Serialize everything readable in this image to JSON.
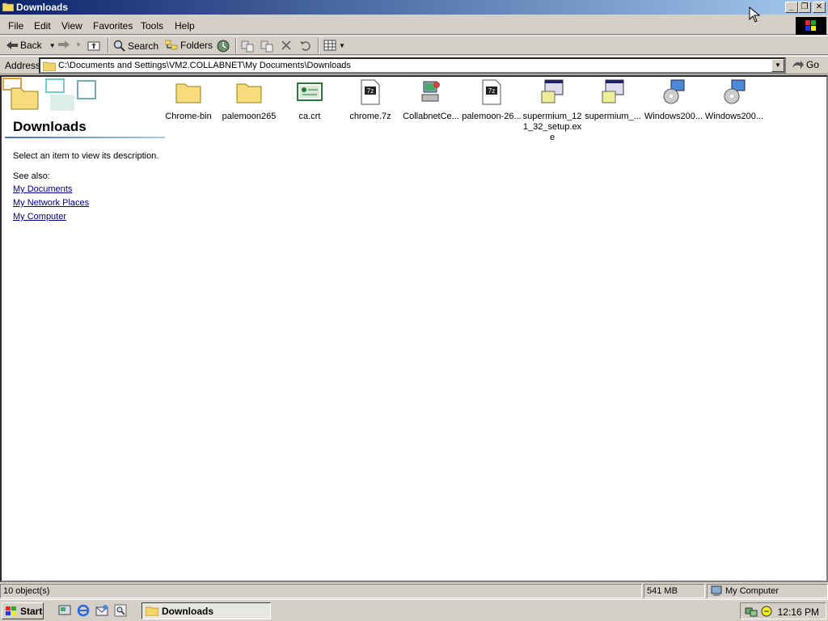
{
  "window": {
    "title": "Downloads",
    "min_label": "_",
    "max_label": "❐",
    "close_label": "✕"
  },
  "menu": [
    "File",
    "Edit",
    "View",
    "Favorites",
    "Tools",
    "Help"
  ],
  "toolbar": {
    "back": "Back",
    "search": "Search",
    "folders": "Folders"
  },
  "address": {
    "label": "Address",
    "value": "C:\\Documents and Settings\\VM2.COLLABNET\\My Documents\\Downloads",
    "go": "Go"
  },
  "sidepanel": {
    "folder_name": "Downloads",
    "description": "Select an item to view its description.",
    "see_also": "See also:",
    "links": [
      "My Documents",
      "My Network Places",
      "My Computer"
    ]
  },
  "files": [
    {
      "name": "Chrome-bin",
      "icon": "folder-icon"
    },
    {
      "name": "palemoon265",
      "icon": "folder-icon"
    },
    {
      "name": "ca.crt",
      "icon": "certificate-icon"
    },
    {
      "name": "chrome.7z",
      "icon": "7z-archive-icon"
    },
    {
      "name": "CollabnetCe...",
      "icon": "network-computer-icon"
    },
    {
      "name": "palemoon-26...",
      "icon": "7z-archive-icon"
    },
    {
      "name": "supermium_121_32_setup.exe",
      "icon": "installer-icon"
    },
    {
      "name": "supermium_...",
      "icon": "installer-icon"
    },
    {
      "name": "Windows200...",
      "icon": "windows-setup-icon"
    },
    {
      "name": "Windows200...",
      "icon": "windows-setup-icon"
    }
  ],
  "status": {
    "objects": "10 object(s)",
    "size": "541 MB",
    "zone": "My Computer"
  },
  "taskbar": {
    "start": "Start",
    "task": "Downloads",
    "clock": "12:16 PM"
  }
}
